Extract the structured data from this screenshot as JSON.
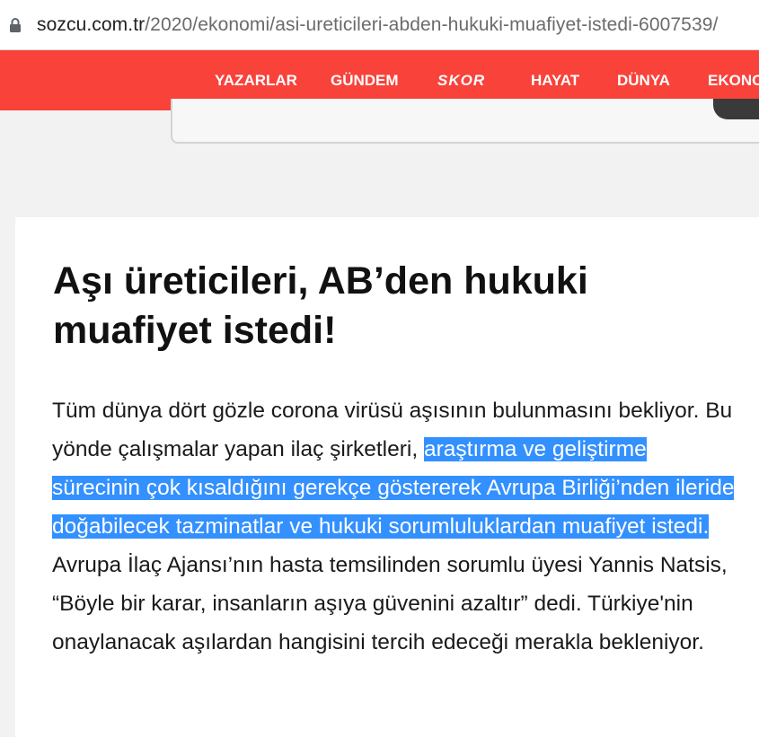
{
  "browser": {
    "url_host": "sozcu.com.tr",
    "url_path": "/2020/ekonomi/asi-ureticileri-abden-hukuki-muafiyet-istedi-6007539/",
    "lock_icon": "lock-icon"
  },
  "nav": {
    "items": [
      "YAZARLAR",
      "GÜNDEM",
      "SKOR",
      "HAYAT",
      "DÜNYA",
      "EKONO"
    ],
    "background_color": "#f8423a"
  },
  "article": {
    "title": "Aşı üreticileri, AB’den hukuki muafiyet istedi!",
    "body_before": "Tüm dünya dört gözle corona virüsü aşısının bulunmasını bekliyor. Bu yönde çalışmalar yapan ilaç şirketleri, ",
    "body_selected": "araştırma ve geliştirme sürecinin çok kısaldığını gerekçe göstererek Avrupa Birliği’nden ileride doğabilecek tazminatlar ve hukuki sorumluluklardan muafiyet istedi.",
    "body_after": " Avrupa İlaç Ajansı’nın hasta temsilinden sorumlu üyesi Yannis Natsis, “Böyle bir karar, insanların aşıya güvenini azaltır” dedi. Türkiye'nin onaylanacak aşılardan hangisini tercih edeceği merakla bekleniyor.",
    "selection_color": "#3390ff"
  }
}
